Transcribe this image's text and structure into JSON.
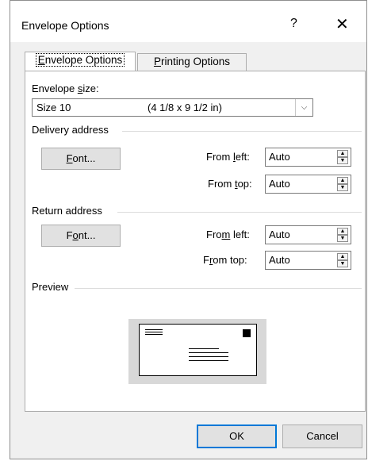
{
  "dialog": {
    "title": "Envelope Options",
    "help_glyph": "?",
    "close_glyph": "✕"
  },
  "tabs": [
    {
      "label_pre": "",
      "accel": "E",
      "label_post": "nvelope Options",
      "active": true
    },
    {
      "label_pre": "",
      "accel": "P",
      "label_post": "rinting Options",
      "active": false
    }
  ],
  "envelope_size": {
    "label_pre": "Envelope ",
    "accel": "s",
    "label_post": "ize:",
    "selected_name": "Size 10",
    "selected_dims": "(4 1/8 x 9 1/2 in)"
  },
  "delivery": {
    "group_label": "Delivery address",
    "font_button": {
      "pre": "",
      "accel": "F",
      "post": "ont..."
    },
    "from_left": {
      "pre": "From ",
      "accel": "l",
      "post": "eft:",
      "value": "Auto"
    },
    "from_top": {
      "pre": "From ",
      "accel": "t",
      "post": "op:",
      "value": "Auto"
    }
  },
  "return": {
    "group_label": "Return address",
    "font_button": {
      "pre": "F",
      "accel": "o",
      "post": "nt..."
    },
    "from_left": {
      "pre": "Fro",
      "accel": "m",
      "post": " left:",
      "value": "Auto"
    },
    "from_top": {
      "pre": "F",
      "accel": "r",
      "post": "om top:",
      "value": "Auto"
    }
  },
  "preview": {
    "group_label": "Preview"
  },
  "footer": {
    "ok": "OK",
    "cancel": "Cancel"
  },
  "colors": {
    "dialog_bg": "#f0f0f0",
    "panel_bg": "#ffffff",
    "default_button_border": "#0078d7"
  }
}
